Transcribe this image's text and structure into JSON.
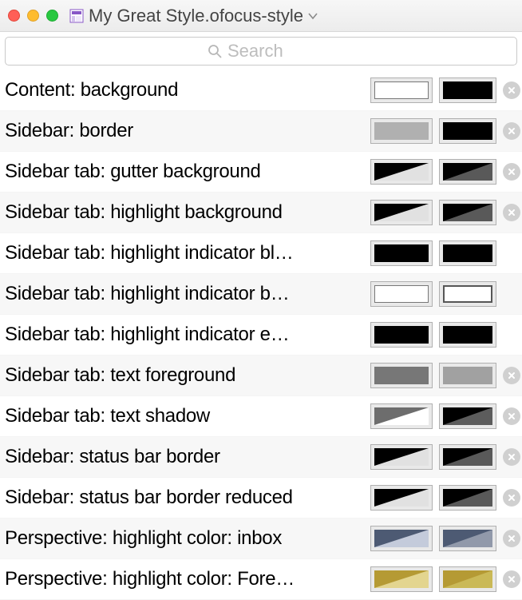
{
  "window": {
    "title": "My Great Style.ofocus-style"
  },
  "search": {
    "placeholder": "Search"
  },
  "rows": [
    {
      "label": "Content: background",
      "light": {
        "type": "solid",
        "fill": "#ffffff",
        "bordered": true
      },
      "dark": {
        "type": "solid",
        "fill": "#000000"
      },
      "clear": true
    },
    {
      "label": "Sidebar: border",
      "light": {
        "type": "solid",
        "fill": "#b0b0b0"
      },
      "dark": {
        "type": "solid",
        "fill": "#000000"
      },
      "clear": true
    },
    {
      "label": "Sidebar tab: gutter background",
      "light": {
        "type": "split",
        "a": "#000000",
        "b": "#e1e1e1"
      },
      "dark": {
        "type": "split",
        "a": "#000000",
        "b": "#595959"
      },
      "clear": true
    },
    {
      "label": "Sidebar tab: highlight background",
      "light": {
        "type": "split",
        "a": "#000000",
        "b": "#e1e1e1"
      },
      "dark": {
        "type": "split",
        "a": "#000000",
        "b": "#595959"
      },
      "clear": true
    },
    {
      "label": "Sidebar tab: highlight indicator bl…",
      "light": {
        "type": "solid",
        "fill": "#000000"
      },
      "dark": {
        "type": "solid",
        "fill": "#000000"
      },
      "clear": false
    },
    {
      "label": "Sidebar tab: highlight indicator b…",
      "light": {
        "type": "solid",
        "fill": "#ffffff",
        "bordered": true
      },
      "dark": {
        "type": "hollow"
      },
      "clear": false
    },
    {
      "label": "Sidebar tab: highlight indicator e…",
      "light": {
        "type": "solid",
        "fill": "#000000"
      },
      "dark": {
        "type": "solid",
        "fill": "#000000"
      },
      "clear": false
    },
    {
      "label": "Sidebar tab: text foreground",
      "light": {
        "type": "solid",
        "fill": "#777777"
      },
      "dark": {
        "type": "solid",
        "fill": "#a1a1a1"
      },
      "clear": true
    },
    {
      "label": "Sidebar tab: text shadow",
      "light": {
        "type": "split",
        "a": "#6d6d6d",
        "b": "#ffffff"
      },
      "dark": {
        "type": "split",
        "a": "#000000",
        "b": "#5c5c5c"
      },
      "clear": true
    },
    {
      "label": "Sidebar: status bar border",
      "light": {
        "type": "split",
        "a": "#000000",
        "b": "#e1e1e1"
      },
      "dark": {
        "type": "split",
        "a": "#000000",
        "b": "#595959"
      },
      "clear": true
    },
    {
      "label": "Sidebar: status bar border reduced",
      "light": {
        "type": "split",
        "a": "#000000",
        "b": "#e1e1e1"
      },
      "dark": {
        "type": "split",
        "a": "#000000",
        "b": "#595959"
      },
      "clear": true
    },
    {
      "label": "Perspective: highlight color: inbox",
      "light": {
        "type": "split",
        "a": "#4d5a73",
        "b": "#c4cbdb"
      },
      "dark": {
        "type": "split",
        "a": "#4d5a73",
        "b": "#9199aa"
      },
      "clear": true
    },
    {
      "label": "Perspective: highlight color: Fore…",
      "light": {
        "type": "split",
        "a": "#b59a34",
        "b": "#e3d58f"
      },
      "dark": {
        "type": "split",
        "a": "#b59a34",
        "b": "#cab957"
      },
      "clear": true
    }
  ]
}
